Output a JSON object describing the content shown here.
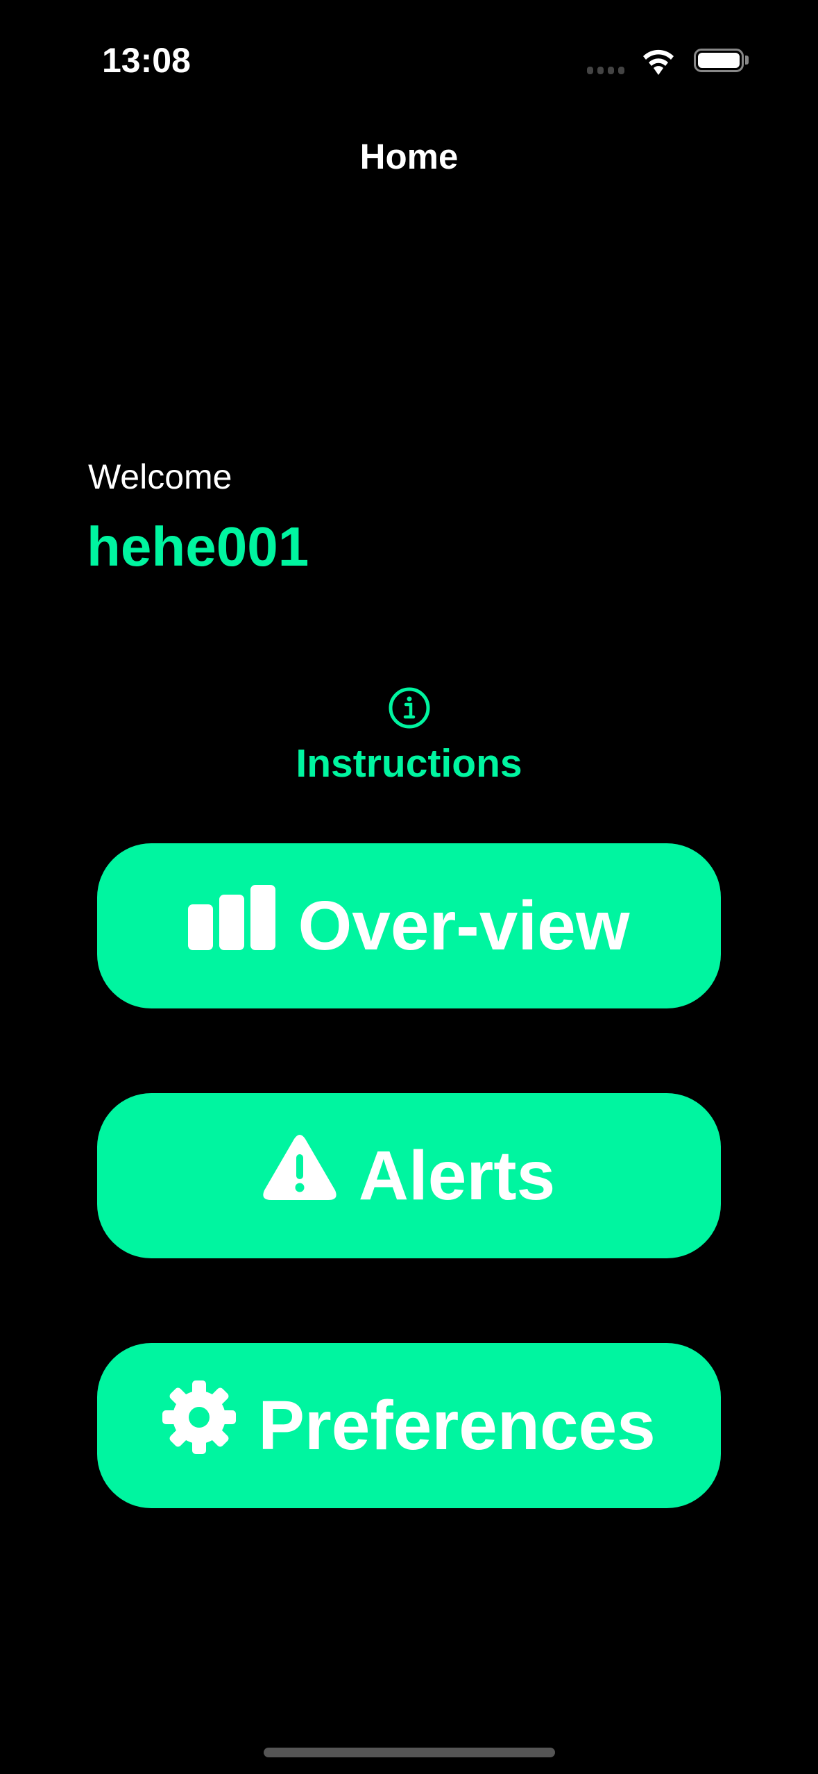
{
  "colors": {
    "accent": "#00F5A0",
    "background": "#000000"
  },
  "status_bar": {
    "time": "13:08",
    "icons": [
      "signal-icon",
      "wifi-icon",
      "battery-icon"
    ]
  },
  "nav": {
    "title": "Home"
  },
  "greeting": {
    "welcome": "Welcome",
    "username": "hehe001"
  },
  "instructions": {
    "icon": "info-circle-icon",
    "label": "Instructions"
  },
  "buttons": [
    {
      "icon": "bar-chart-icon",
      "label": "Over-view"
    },
    {
      "icon": "warning-triangle-icon",
      "label": "Alerts"
    },
    {
      "icon": "gear-icon",
      "label": "Preferences"
    }
  ]
}
